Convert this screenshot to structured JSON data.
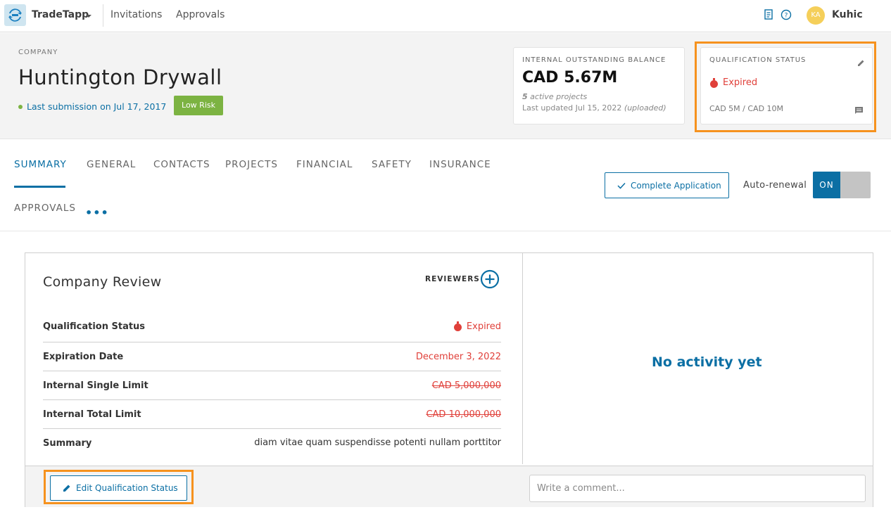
{
  "topnav": {
    "app_name": "TradeTapp",
    "links": [
      "Invitations",
      "Approvals"
    ],
    "avatar_initials": "KA",
    "user_name": "Kuhic",
    "icons": [
      "document-icon",
      "help-icon"
    ]
  },
  "header": {
    "company_label": "COMPANY",
    "company_name": "Huntington Drywall",
    "last_submission": "Last submission on Jul 17, 2017",
    "risk_badge": "Low Risk",
    "balance_card": {
      "label": "INTERNAL OUTSTANDING BALANCE",
      "value": "CAD 5.67M",
      "active_count": "5",
      "active_text": "active projects",
      "updated_text": "Last updated Jul 15, 2022",
      "updated_note": "(uploaded)"
    },
    "qualification_card": {
      "label": "QUALIFICATION STATUS",
      "status": "Expired",
      "limits": "CAD 5M / CAD 10M"
    }
  },
  "tabs": [
    "SUMMARY",
    "GENERAL",
    "CONTACTS",
    "PROJECTS",
    "FINANCIAL",
    "SAFETY",
    "INSURANCE",
    "APPROVALS"
  ],
  "active_tab": "SUMMARY",
  "more_label": "•••",
  "actions": {
    "complete_application": "Complete Application",
    "auto_renewal_label": "Auto-renewal",
    "toggle_state": "ON"
  },
  "review": {
    "title": "Company Review",
    "reviewers_label": "REVIEWERS",
    "rows": [
      {
        "label": "Qualification Status",
        "value": "Expired"
      },
      {
        "label": "Expiration Date",
        "value": "December 3, 2022"
      },
      {
        "label": "Internal Single Limit",
        "value": "CAD 5,000,000"
      },
      {
        "label": "Internal Total Limit",
        "value": "CAD 10,000,000"
      },
      {
        "label": "Summary",
        "value": "diam vitae quam suspendisse potenti nullam porttitor"
      }
    ],
    "no_activity": "No activity yet",
    "edit_button": "Edit Qualification Status",
    "comment_placeholder": "Write a comment..."
  },
  "colors": {
    "accent": "#0b6fa4",
    "expired": "#e0403a",
    "risk": "#7cb342",
    "highlight": "#f6921e"
  }
}
